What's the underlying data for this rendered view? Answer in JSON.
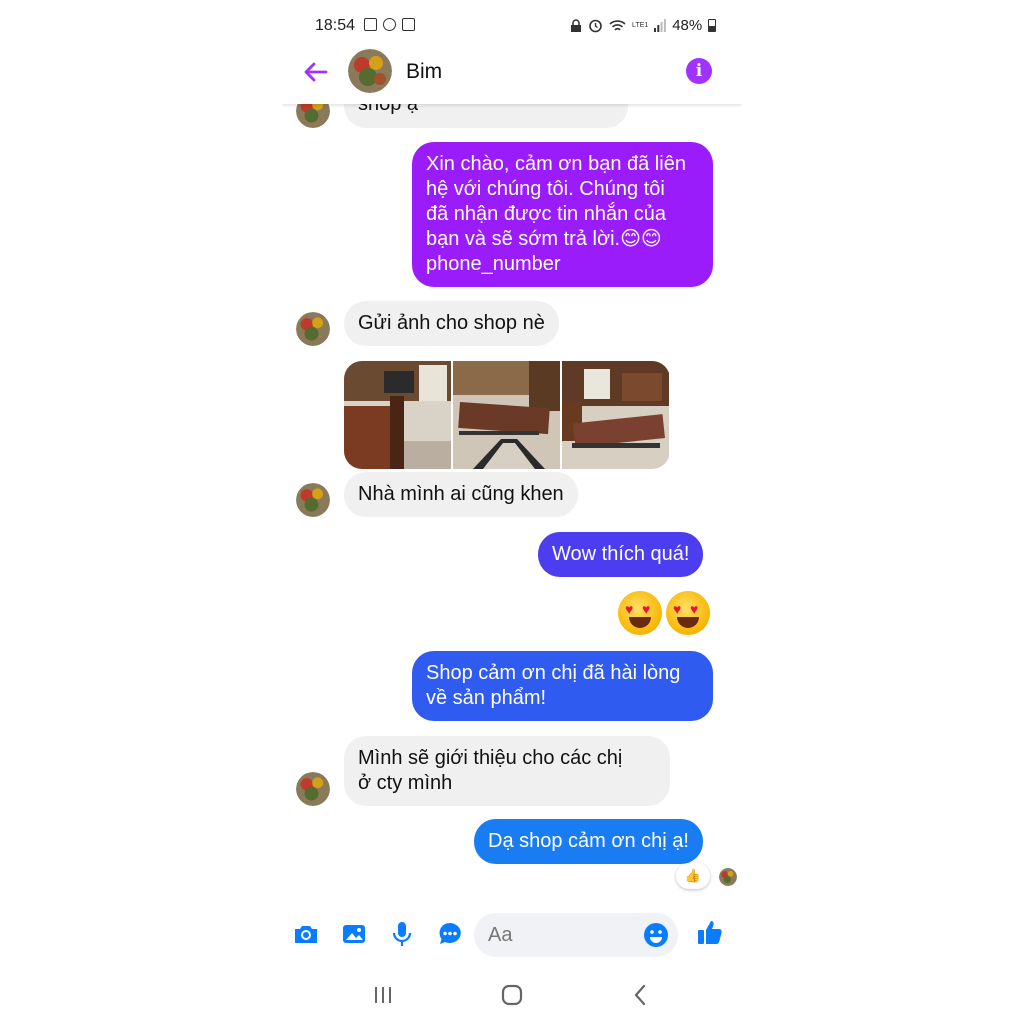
{
  "status_bar": {
    "time": "18:54",
    "battery": "48%",
    "network": "LTE1"
  },
  "header": {
    "contact_name": "Bim"
  },
  "messages": [
    {
      "id": "m0",
      "direction": "in",
      "text": "shop ạ"
    },
    {
      "id": "m1",
      "direction": "out",
      "text": "Xin chào, cảm ơn bạn đã liên\nhệ với chúng tôi. Chúng tôi\nđã nhận được tin nhắn của\nbạn và sẽ sớm trả lời.😊😊\nphone_number",
      "color": "#9b1cfa"
    },
    {
      "id": "m2",
      "direction": "in",
      "text": "Gửi ảnh cho shop nè"
    },
    {
      "id": "m3",
      "direction": "in",
      "type": "photos",
      "count": 3
    },
    {
      "id": "m4",
      "direction": "in",
      "text": "Nhà mình ai cũng khen"
    },
    {
      "id": "m5",
      "direction": "out",
      "text": "Wow thích quá!",
      "color": "#4c3df0"
    },
    {
      "id": "m6",
      "direction": "out",
      "type": "emoji",
      "text": "😍😍"
    },
    {
      "id": "m7",
      "direction": "out",
      "text": "Shop cảm ơn chị đã hài lòng\nvề sản phẩm!",
      "color": "#2f5bf0"
    },
    {
      "id": "m8",
      "direction": "in",
      "text": "Mình sẽ giới thiệu cho các chị\nở cty mình"
    },
    {
      "id": "m9",
      "direction": "out",
      "text": "Dạ shop cảm ơn chị ạ!",
      "color": "#1a7cf2",
      "reaction": "👍"
    }
  ],
  "composer": {
    "placeholder": "Aa"
  },
  "colors": {
    "accent_purple": "#a033ff",
    "messenger_blue": "#0a7cff",
    "incoming_bubble": "#f0f0f0"
  },
  "icons": [
    "back-arrow-icon",
    "info-icon",
    "camera-icon",
    "image-icon",
    "microphone-icon",
    "chat-bubble-icon",
    "smiley-icon",
    "thumbs-up-icon",
    "recents-icon",
    "home-icon",
    "back-icon"
  ]
}
